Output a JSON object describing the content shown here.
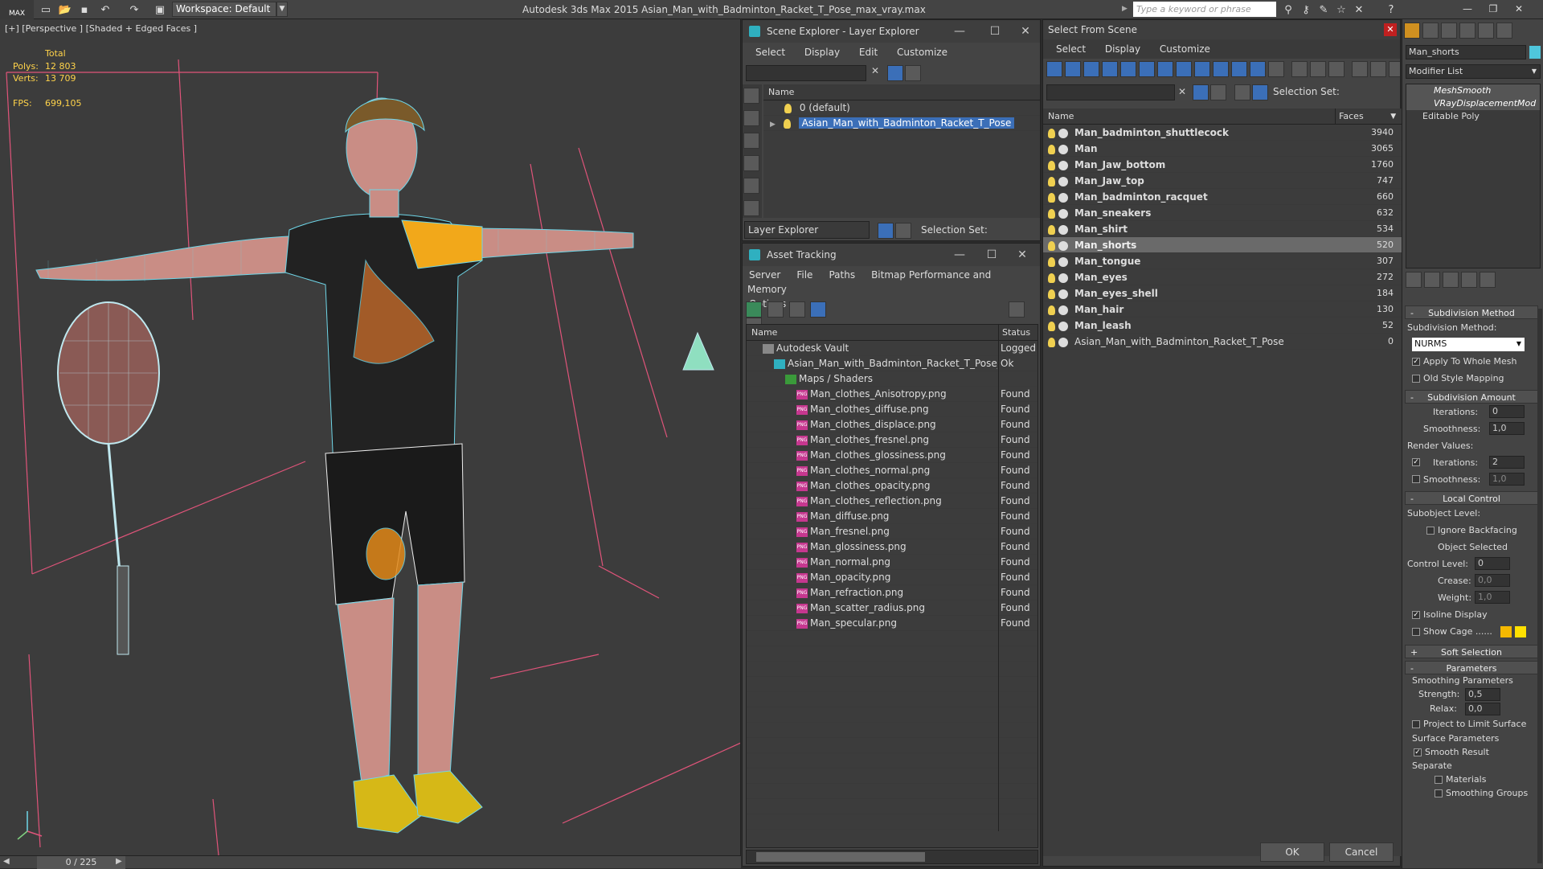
{
  "app": {
    "logo_text": "MAX",
    "workspace": "Workspace: Default",
    "title": "Autodesk 3ds Max  2015    Asian_Man_with_Badminton_Racket_T_Pose_max_vray.max",
    "search_placeholder": "Type a keyword or phrase"
  },
  "viewport": {
    "label": "[+] [Perspective ] [Shaded + Edged Faces ]",
    "stats": {
      "total_label": "Total",
      "polys_label": "Polys:",
      "polys_value": "12 803",
      "verts_label": "Verts:",
      "verts_value": "13 709",
      "fps_label": "FPS:",
      "fps_value": "699,105"
    },
    "timeline_counter": "0 / 225",
    "colors": {
      "background": "#3c3c3c",
      "wire_skin": "#6fd6e8",
      "shirt_accent": "#f2a81a"
    }
  },
  "scene_explorer": {
    "title": "Scene Explorer - Layer Explorer",
    "menu": [
      "Select",
      "Display",
      "Edit",
      "Customize"
    ],
    "column_name": "Name",
    "layers": [
      {
        "name": "0 (default)",
        "selected": false
      },
      {
        "name": "Asian_Man_with_Badminton_Racket_T_Pose",
        "selected": true
      }
    ],
    "footer_dropdown": "Layer Explorer",
    "selection_set_label": "Selection Set:"
  },
  "asset_tracking": {
    "title": "Asset Tracking",
    "menu": [
      "Server",
      "File",
      "Paths",
      "Bitmap Performance and Memory",
      "Options"
    ],
    "col_name": "Name",
    "col_status": "Status",
    "rows": [
      {
        "name": "Autodesk Vault",
        "status": "Logged",
        "indent": 1,
        "icon": "vault"
      },
      {
        "name": "Asian_Man_with_Badminton_Racket_T_Pose_m...",
        "status": "Ok",
        "indent": 2,
        "icon": "max"
      },
      {
        "name": "Maps / Shaders",
        "status": "",
        "indent": 3,
        "icon": "maps"
      },
      {
        "name": "Man_clothes_Anisotropy.png",
        "status": "Found",
        "indent": 4,
        "icon": "png"
      },
      {
        "name": "Man_clothes_diffuse.png",
        "status": "Found",
        "indent": 4,
        "icon": "png"
      },
      {
        "name": "Man_clothes_displace.png",
        "status": "Found",
        "indent": 4,
        "icon": "png"
      },
      {
        "name": "Man_clothes_fresnel.png",
        "status": "Found",
        "indent": 4,
        "icon": "png"
      },
      {
        "name": "Man_clothes_glossiness.png",
        "status": "Found",
        "indent": 4,
        "icon": "png"
      },
      {
        "name": "Man_clothes_normal.png",
        "status": "Found",
        "indent": 4,
        "icon": "png"
      },
      {
        "name": "Man_clothes_opacity.png",
        "status": "Found",
        "indent": 4,
        "icon": "png"
      },
      {
        "name": "Man_clothes_reflection.png",
        "status": "Found",
        "indent": 4,
        "icon": "png"
      },
      {
        "name": "Man_diffuse.png",
        "status": "Found",
        "indent": 4,
        "icon": "png"
      },
      {
        "name": "Man_fresnel.png",
        "status": "Found",
        "indent": 4,
        "icon": "png"
      },
      {
        "name": "Man_glossiness.png",
        "status": "Found",
        "indent": 4,
        "icon": "png"
      },
      {
        "name": "Man_normal.png",
        "status": "Found",
        "indent": 4,
        "icon": "png"
      },
      {
        "name": "Man_opacity.png",
        "status": "Found",
        "indent": 4,
        "icon": "png"
      },
      {
        "name": "Man_refraction.png",
        "status": "Found",
        "indent": 4,
        "icon": "png"
      },
      {
        "name": "Man_scatter_radius.png",
        "status": "Found",
        "indent": 4,
        "icon": "png"
      },
      {
        "name": "Man_specular.png",
        "status": "Found",
        "indent": 4,
        "icon": "png"
      }
    ]
  },
  "select_from_scene": {
    "title": "Select From Scene",
    "menu": [
      "Select",
      "Display",
      "Customize"
    ],
    "selection_set_label": "Selection Set:",
    "col_name": "Name",
    "col_faces": "Faces",
    "rows": [
      {
        "name": "Man_badminton_shuttlecock",
        "faces": "3940",
        "bold": true,
        "selected": false
      },
      {
        "name": "Man",
        "faces": "3065",
        "bold": true,
        "selected": false
      },
      {
        "name": "Man_Jaw_bottom",
        "faces": "1760",
        "bold": true,
        "selected": false
      },
      {
        "name": "Man_Jaw_top",
        "faces": "747",
        "bold": true,
        "selected": false
      },
      {
        "name": "Man_badminton_racquet",
        "faces": "660",
        "bold": true,
        "selected": false
      },
      {
        "name": "Man_sneakers",
        "faces": "632",
        "bold": true,
        "selected": false
      },
      {
        "name": "Man_shirt",
        "faces": "534",
        "bold": true,
        "selected": false
      },
      {
        "name": "Man_shorts",
        "faces": "520",
        "bold": true,
        "selected": true
      },
      {
        "name": "Man_tongue",
        "faces": "307",
        "bold": true,
        "selected": false
      },
      {
        "name": "Man_eyes",
        "faces": "272",
        "bold": true,
        "selected": false
      },
      {
        "name": "Man_eyes_shell",
        "faces": "184",
        "bold": true,
        "selected": false
      },
      {
        "name": "Man_hair",
        "faces": "130",
        "bold": true,
        "selected": false
      },
      {
        "name": "Man_leash",
        "faces": "52",
        "bold": true,
        "selected": false
      },
      {
        "name": "Asian_Man_with_Badminton_Racket_T_Pose",
        "faces": "0",
        "bold": false,
        "selected": false
      }
    ],
    "ok_label": "OK",
    "cancel_label": "Cancel"
  },
  "command_panel": {
    "object_name": "Man_shorts",
    "modifier_list": "Modifier List",
    "stack": [
      "MeshSmooth",
      "VRayDisplacementMod",
      "Editable Poly"
    ],
    "subdivision_method": {
      "header": "Subdivision Method",
      "label": "Subdivision Method:",
      "value": "NURMS",
      "apply_whole": "Apply To Whole Mesh",
      "apply_whole_checked": true,
      "old_style": "Old Style Mapping",
      "old_style_checked": false
    },
    "subdivision_amount": {
      "header": "Subdivision Amount",
      "iterations_label": "Iterations:",
      "iterations": "0",
      "smoothness_label": "Smoothness:",
      "smoothness": "1,0",
      "render_values": "Render Values:",
      "render_iterations": "2",
      "render_iterations_checked": true,
      "render_smoothness": "1,0",
      "render_smoothness_checked": false
    },
    "local_control": {
      "header": "Local Control",
      "subobject_level": "Subobject Level:",
      "ignore_backfacing": "Ignore Backfacing",
      "object_selected": "Object Selected",
      "control_level_label": "Control Level:",
      "control_level": "0",
      "crease_label": "Crease:",
      "crease": "0,0",
      "weight_label": "Weight:",
      "weight": "1,0",
      "isoline": "Isoline Display",
      "isoline_checked": true,
      "show_cage": "Show Cage ......",
      "show_cage_checked": false,
      "cage_color_1": "#f5b800",
      "cage_color_2": "#ffe000"
    },
    "soft_selection": {
      "header": "Soft Selection"
    },
    "parameters": {
      "header": "Parameters",
      "smoothing_parameters": "Smoothing Parameters",
      "strength_label": "Strength:",
      "strength": "0,5",
      "relax_label": "Relax:",
      "relax": "0,0",
      "project_limit": "Project to Limit Surface",
      "surface_parameters": "Surface Parameters",
      "smooth_result": "Smooth Result",
      "smooth_result_checked": true,
      "separate": "Separate",
      "materials": "Materials",
      "smoothing_groups": "Smoothing Groups"
    }
  }
}
